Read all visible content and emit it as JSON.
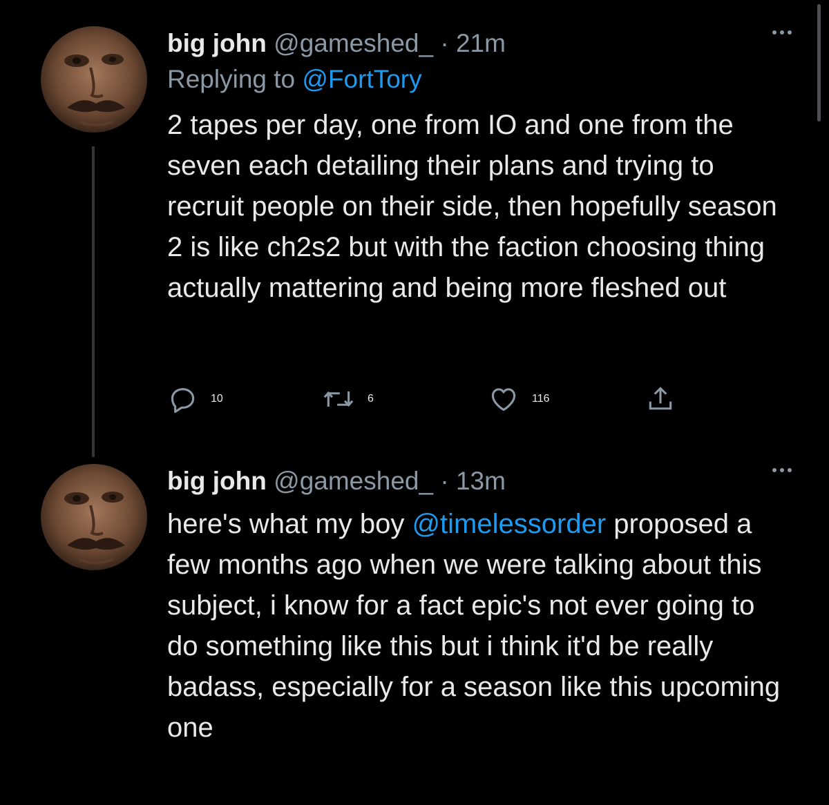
{
  "tweets": [
    {
      "display_name": "big john",
      "handle": "@gameshed_",
      "separator": "·",
      "time": "21m",
      "replying_prefix": "Replying to",
      "replying_to": "@FortTory",
      "text": "2 tapes per day, one from IO and one from the seven each detailing their plans and trying to recruit people on their side, then hopefully season 2 is like ch2s2 but with the faction choosing thing actually mattering and being more fleshed out",
      "counts": {
        "replies": "10",
        "retweets": "6",
        "likes": "116"
      }
    },
    {
      "display_name": "big john",
      "handle": "@gameshed_",
      "separator": "·",
      "time": "13m",
      "text_before": "here's what my boy ",
      "mention": "@timelessorder",
      "text_after": " proposed a few months ago when we were talking about this subject, i know for a fact epic's not ever going to do something like this but i think it'd be really badass, especially for a season like this upcoming one"
    }
  ],
  "icons": [
    "avatar",
    "more-icon",
    "reply-icon",
    "retweet-icon",
    "like-icon",
    "share-icon"
  ],
  "colors": {
    "background": "#000000",
    "text": "#e7e9ea",
    "muted": "#8b98a5",
    "link": "#1d9bf0"
  }
}
